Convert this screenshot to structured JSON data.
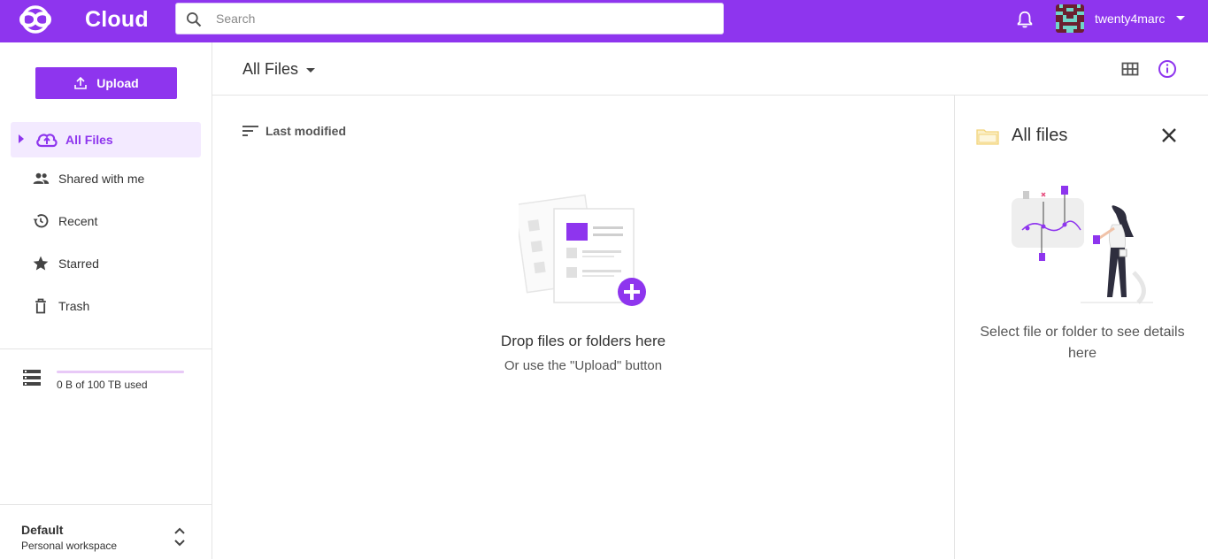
{
  "app": {
    "name": "Cloud"
  },
  "search": {
    "placeholder": "Search"
  },
  "user": {
    "name": "twenty4marc"
  },
  "sidebar": {
    "upload_label": "Upload",
    "items": [
      {
        "label": "All Files",
        "icon": "cloud-upload-icon",
        "active": true
      },
      {
        "label": "Shared with me",
        "icon": "people-icon"
      },
      {
        "label": "Recent",
        "icon": "history-icon"
      },
      {
        "label": "Starred",
        "icon": "star-icon"
      },
      {
        "label": "Trash",
        "icon": "trash-icon"
      }
    ],
    "storage": {
      "text": "0 B of 100 TB used",
      "used_fraction": 0
    },
    "workspace": {
      "name": "Default",
      "type": "Personal workspace"
    }
  },
  "main": {
    "breadcrumb": "All Files",
    "sort_label": "Last modified",
    "empty_title": "Drop files or folders here",
    "empty_subtitle": "Or use the \"Upload\" button"
  },
  "details": {
    "title": "All files",
    "message": "Select file or folder to see details here"
  },
  "colors": {
    "accent": "#8e35ee",
    "active_bg": "#f3eaff"
  }
}
